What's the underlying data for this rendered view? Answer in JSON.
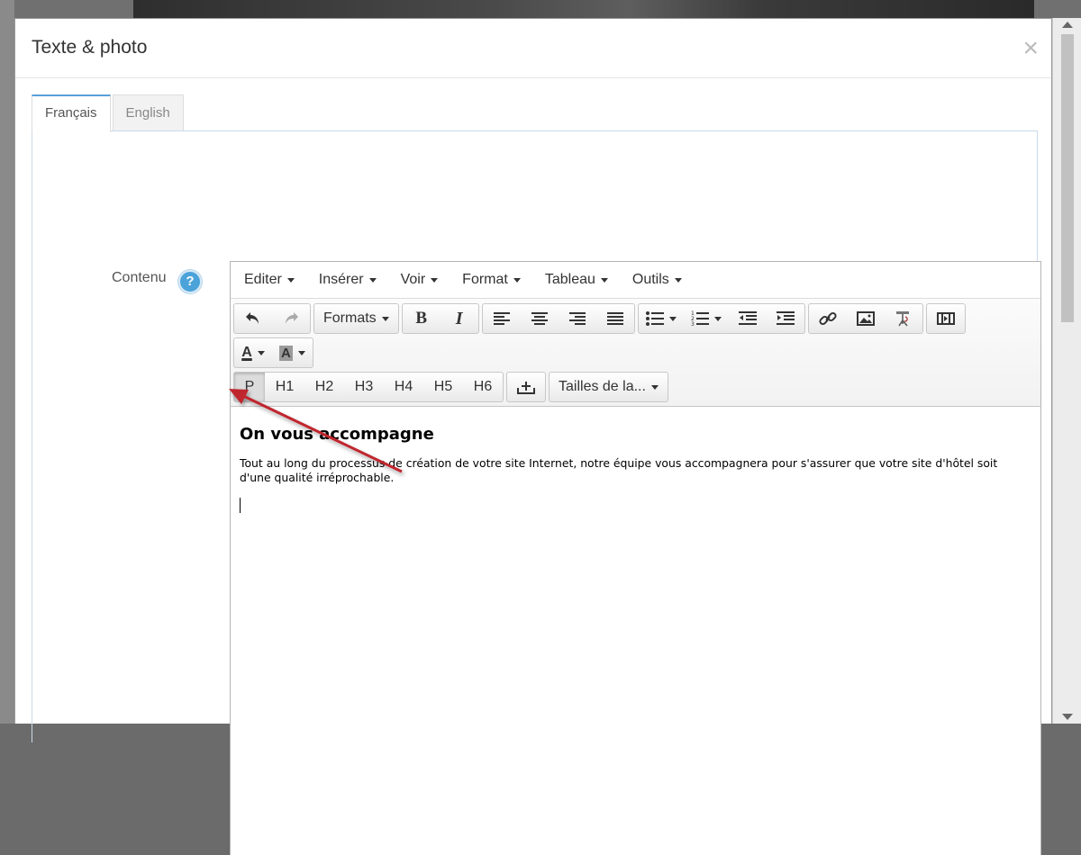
{
  "modal": {
    "title": "Texte & photo",
    "close": "×"
  },
  "tabs": [
    {
      "label": "Français",
      "active": true
    },
    {
      "label": "English",
      "active": false
    }
  ],
  "field": {
    "label": "Contenu",
    "help": "?"
  },
  "menubar": [
    {
      "label": "Editer"
    },
    {
      "label": "Insérer"
    },
    {
      "label": "Voir"
    },
    {
      "label": "Format"
    },
    {
      "label": "Tableau"
    },
    {
      "label": "Outils"
    }
  ],
  "toolbar": {
    "formats_label": "Formats",
    "bold": "B",
    "italic": "I",
    "text_color": "A",
    "bg_color": "A",
    "blocks": [
      "P",
      "H1",
      "H2",
      "H3",
      "H4",
      "H5",
      "H6"
    ],
    "font_size_label": "Tailles de la..."
  },
  "content": {
    "heading": "On vous accompagne",
    "paragraph": "Tout au long du processus de création de votre site Internet, notre équipe vous accompagnera pour s'assurer que votre site d'hôtel soit d'une qualité irréprochable."
  },
  "colors": {
    "accent": "#4ba3d9",
    "annotation_arrow": "#c0272d"
  }
}
